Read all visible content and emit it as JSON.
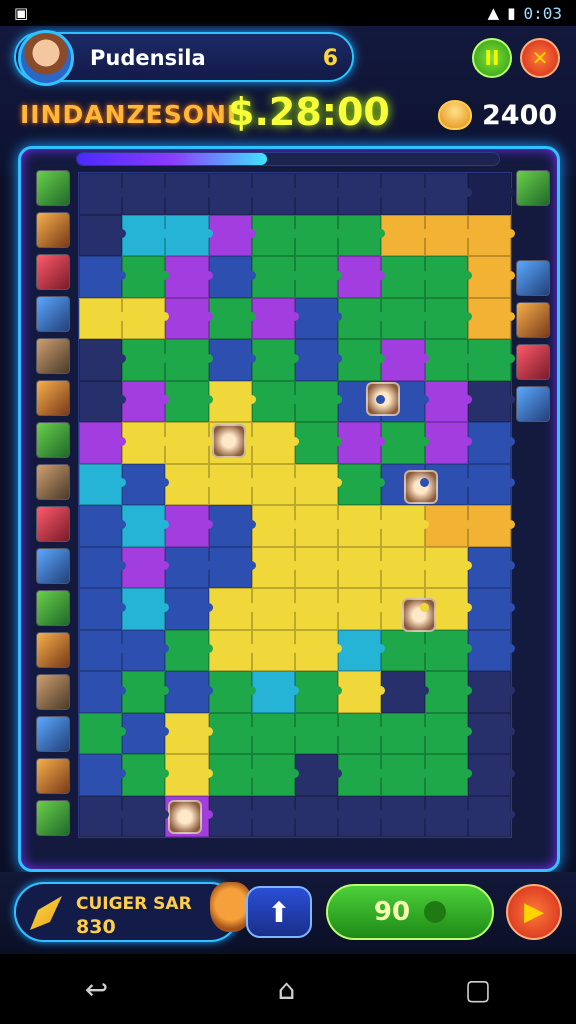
{
  "status": {
    "left_icon": "notification-icon",
    "time": "0:03",
    "signal": "▲",
    "battery": "▮"
  },
  "header": {
    "player_name": "Pudensila",
    "pill_value": "6",
    "level_title": "IINDANZESONI",
    "timer": "$.28:00",
    "coins": "2400",
    "pause_label": "II",
    "close_label": "✕"
  },
  "board": {
    "progress": 0.45,
    "rows": [
      "nnnnnnnnnk",
      "nccpgggooo",
      "bgpbggpggo",
      "yypgpbgggo",
      "nggbgbgpgg",
      "npgyggbbpn",
      "pyyyygpgpb",
      "cbyyyygbbb",
      "bcpbyyyyoo",
      "bpbbyyyyyb",
      "bcbyyyyyyb",
      "bbgyyycggb",
      "bgbgcgyngn",
      "gbyggggggn",
      "bgyggngggn",
      "nnpnnnnnnn"
    ]
  },
  "bottom": {
    "bonus_label": "CUIGER SAR",
    "bonus_value": "830",
    "up_label": "⬆",
    "hint_value": "90",
    "next_label": "▶"
  },
  "nav": {
    "back": "↩",
    "home": "⌂",
    "recents": "▢"
  }
}
